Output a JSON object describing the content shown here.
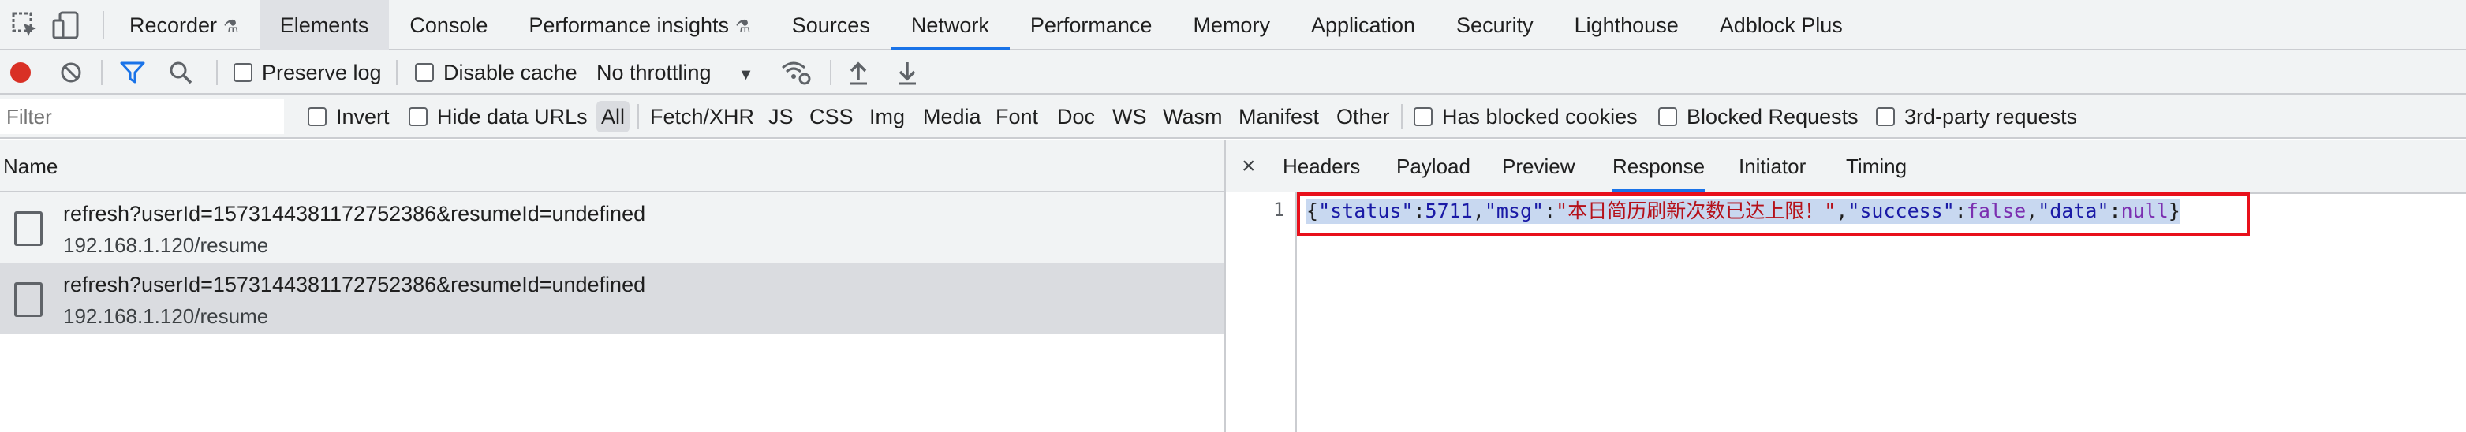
{
  "devtools": {
    "tabs": [
      "Recorder",
      "Elements",
      "Console",
      "Performance insights",
      "Sources",
      "Network",
      "Performance",
      "Memory",
      "Application",
      "Security",
      "Lighthouse",
      "Adblock Plus"
    ],
    "active_tab": "Network",
    "selected_tab": "Elements",
    "icons": [
      "inspect-icon",
      "device-toggle-icon"
    ]
  },
  "toolbar": {
    "preserve_log": "Preserve log",
    "disable_cache": "Disable cache",
    "throttling": "No throttling",
    "icons": [
      "record-icon",
      "clear-icon",
      "filter-icon",
      "search-icon",
      "network-conditions-icon",
      "import-icon",
      "export-icon"
    ]
  },
  "filterbar": {
    "placeholder": "Filter",
    "invert": "Invert",
    "hide_data_urls": "Hide data URLs",
    "types": [
      "All",
      "Fetch/XHR",
      "JS",
      "CSS",
      "Img",
      "Media",
      "Font",
      "Doc",
      "WS",
      "Wasm",
      "Manifest",
      "Other"
    ],
    "has_blocked_cookies": "Has blocked cookies",
    "blocked_requests": "Blocked Requests",
    "third_party": "3rd-party requests"
  },
  "requests": {
    "column_header": "Name",
    "rows": [
      {
        "name": "refresh?userId=1573144381172752386&resumeId=undefined",
        "host": "192.168.1.120/resume"
      },
      {
        "name": "refresh?userId=1573144381172752386&resumeId=undefined",
        "host": "192.168.1.120/resume"
      }
    ],
    "selected_row": 1
  },
  "detail": {
    "close": "×",
    "tabs": [
      "Headers",
      "Payload",
      "Preview",
      "Response",
      "Initiator",
      "Timing"
    ],
    "active_tab": "Response",
    "line_number": "1",
    "response_tokens": {
      "t1": "{",
      "t2": "\"status\"",
      "t3": ":",
      "t4": "5711",
      "t5": ",",
      "t6": "\"msg\"",
      "t7": ":",
      "t8": "\"本日简历刷新次数已达上限！\"",
      "t9": ",",
      "t10": "\"success\"",
      "t11": ":",
      "t12": "false",
      "t13": ",",
      "t14": "\"data\"",
      "t15": ":",
      "t16": "null",
      "t17": "}"
    }
  },
  "colors": {
    "accent": "#1a73e8",
    "record": "#d93025",
    "highlight_box": "#e8101b"
  }
}
